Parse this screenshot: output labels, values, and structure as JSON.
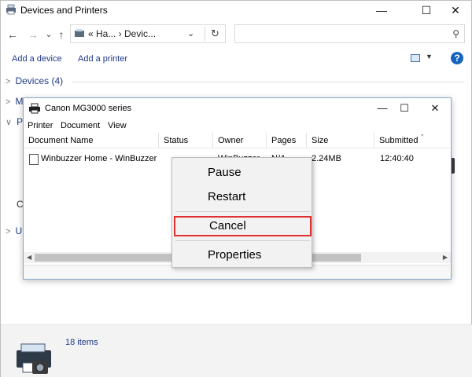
{
  "window": {
    "title": "Devices and Printers",
    "minimize_glyph": "—",
    "maximize_glyph": "☐",
    "close_glyph": "✕"
  },
  "nav": {
    "back_glyph": "←",
    "forward_glyph": "→",
    "recent_glyph": "⌄",
    "up_glyph": "↑",
    "address_text": "« Ha... › Devic...",
    "address_dropdown_glyph": "⌄",
    "refresh_glyph": "↻",
    "search_placeholder": "",
    "search_glyph": "⚲"
  },
  "commands": {
    "add_device": "Add a device",
    "add_printer": "Add a printer",
    "view_dropdown_glyph": "▼",
    "help_glyph": "?"
  },
  "groups": {
    "devices": "Devices (4)",
    "collapsed_glyph": ">",
    "expanded_glyph": "∨",
    "truncated_m": "M",
    "truncated_pr": "Pr",
    "truncated_c": "C",
    "truncated_u": "U"
  },
  "status": {
    "item_count": "18 items"
  },
  "dialog": {
    "title": "Canon MG3000 series",
    "minimize_glyph": "—",
    "maximize_glyph": "☐",
    "close_glyph": "✕",
    "menu": [
      "Printer",
      "Document",
      "View"
    ],
    "columns": [
      "Document Name",
      "Status",
      "Owner",
      "Pages",
      "Size",
      "Submitted"
    ],
    "sort_glyph": "⌄",
    "job": {
      "name": "Winbuzzer Home - WinBuzzer",
      "status": "",
      "owner": "WinBuzzer",
      "pages": "N/A",
      "size": "2.24MB",
      "submitted": "12:40:40"
    },
    "scroll_left_glyph": "◀",
    "scroll_right_glyph": "▶"
  },
  "context_menu": {
    "items": [
      "Pause",
      "Restart",
      "Cancel",
      "Properties"
    ],
    "highlighted": "Cancel",
    "highlight_color": "#e03030"
  },
  "colors": {
    "link_blue": "#1e3a8a",
    "help_blue": "#1565c0"
  }
}
